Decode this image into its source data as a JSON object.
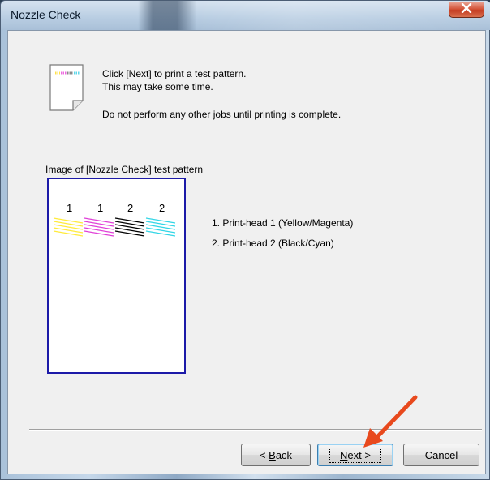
{
  "window": {
    "title": "Nozzle Check",
    "close_label": "x"
  },
  "message": {
    "line1": "Click [Next] to print a test pattern.",
    "line2": "This may take some time.",
    "line3": "Do not perform any other jobs until printing is complete."
  },
  "pattern": {
    "label": "Image of [Nozzle Check] test pattern",
    "head_numbers": [
      "1",
      "1",
      "2",
      "2"
    ],
    "colors": {
      "yellow": "#ffeb3b",
      "magenta": "#e040d8",
      "black": "#000000",
      "cyan": "#33d6e6"
    },
    "legend": [
      "1. Print-head 1 (Yellow/Magenta)",
      "2. Print-head 2 (Black/Cyan)"
    ]
  },
  "buttons": {
    "back_prefix": "< ",
    "back_mnemonic": "B",
    "back_rest": "ack",
    "next_mnemonic": "N",
    "next_rest": "ext >",
    "cancel": "Cancel"
  },
  "annotation": {
    "arrow_color": "#e8491d"
  }
}
